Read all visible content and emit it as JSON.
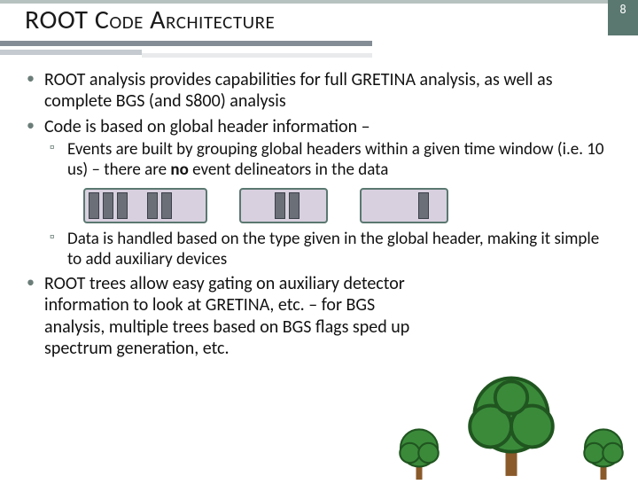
{
  "header": {
    "title_root": "ROOT",
    "title_rest": " Code Architecture",
    "page_number": "8"
  },
  "bullets": {
    "b1": "ROOT analysis provides capabilities for full GRETINA analysis, as well as complete BGS (and S800) analysis",
    "b2": "Code is based on global header information –",
    "b2_sub1_pre": "Events are built by grouping global headers within a given time window (i.e. 10 us) – there are ",
    "b2_sub1_bold": "no",
    "b2_sub1_post": " event delineators in the data",
    "b2_sub2": "Data is handled based on the type given in the global header, making it simple to add auxiliary devices",
    "b3": "ROOT trees allow easy gating on auxiliary detector information to look at GRETINA, etc. – for BGS analysis, multiple trees based on BGS flags sped up spectrum generation, etc."
  }
}
